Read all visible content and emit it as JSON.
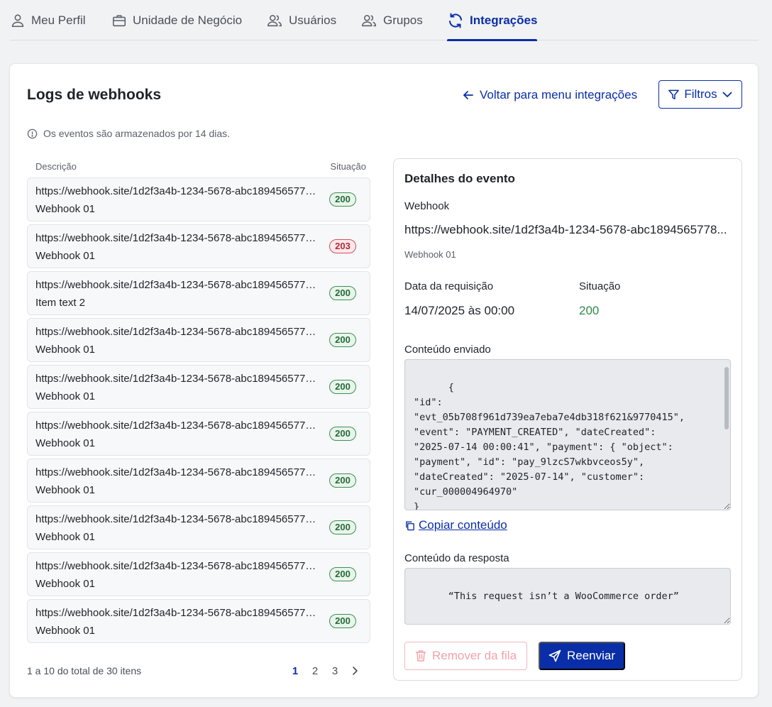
{
  "tabs": [
    {
      "label": "Meu Perfil",
      "icon": "user-icon"
    },
    {
      "label": "Unidade de Negócio",
      "icon": "briefcase-icon"
    },
    {
      "label": "Usuários",
      "icon": "users-icon"
    },
    {
      "label": "Grupos",
      "icon": "users-icon"
    },
    {
      "label": "Integrações",
      "icon": "sync-icon",
      "active": true
    }
  ],
  "header": {
    "title": "Logs de webhooks",
    "back_label": "Voltar para menu integrações",
    "filters_label": "Filtros",
    "info_note": "Os eventos são armazenados por 14 dias."
  },
  "list": {
    "col_description": "Descrição",
    "col_status": "Situação",
    "items": [
      {
        "url": "https://webhook.site/1d2f3a4b-1234-5678-abc1894565778...",
        "name": "Webhook 01",
        "status": "200"
      },
      {
        "url": "https://webhook.site/1d2f3a4b-1234-5678-abc1894565778...",
        "name": "Webhook 01",
        "status": "203"
      },
      {
        "url": "https://webhook.site/1d2f3a4b-1234-5678-abc1894565778...",
        "name": "Item text 2",
        "status": "200"
      },
      {
        "url": "https://webhook.site/1d2f3a4b-1234-5678-abc1894565778...",
        "name": "Webhook 01",
        "status": "200"
      },
      {
        "url": "https://webhook.site/1d2f3a4b-1234-5678-abc1894565778...",
        "name": "Webhook 01",
        "status": "200"
      },
      {
        "url": "https://webhook.site/1d2f3a4b-1234-5678-abc1894565778...",
        "name": "Webhook 01",
        "status": "200"
      },
      {
        "url": "https://webhook.site/1d2f3a4b-1234-5678-abc1894565778...",
        "name": "Webhook 01",
        "status": "200"
      },
      {
        "url": "https://webhook.site/1d2f3a4b-1234-5678-abc1894565778...",
        "name": "Webhook 01",
        "status": "200"
      },
      {
        "url": "https://webhook.site/1d2f3a4b-1234-5678-abc1894565778...",
        "name": "Webhook 01",
        "status": "200"
      },
      {
        "url": "https://webhook.site/1d2f3a4b-1234-5678-abc1894565778...",
        "name": "Webhook 01",
        "status": "200"
      }
    ]
  },
  "pagination": {
    "info": "1 a 10 do total de 30 itens",
    "pages": [
      "1",
      "2",
      "3"
    ],
    "current": "1"
  },
  "details": {
    "title": "Detalhes do evento",
    "webhook_label": "Webhook",
    "webhook_url": "https://webhook.site/1d2f3a4b-1234-5678-abc1894565778...",
    "webhook_name": "Webhook 01",
    "date_label": "Data da requisição",
    "date_value": "14/07/2025 às 00:00",
    "status_label": "Situação",
    "status_value": "200",
    "sent_label": "Conteúdo enviado",
    "sent_content": "{\n\"id\":\n\"evt_05b708f961d739ea7eba7e4db318f621&9770415\",\n\"event\": \"PAYMENT_CREATED\", \"dateCreated\":\n\"2025-07-14 00:00:41\", \"payment\": { \"object\":\n\"payment\", \"id\": \"pay_9lzcS7wkbvceos5y\",\n\"dateCreated\": \"2025-07-14\", \"customer\":\n\"cur_000004964970\"\n}",
    "copy_label": "Copiar conteúdo",
    "response_label": "Conteúdo da resposta",
    "response_content": "“This request isn’t a WooCommerce order”",
    "remove_label": "Remover da fila",
    "resend_label": "Reenviar"
  },
  "colors": {
    "primary": "#0a2ea8",
    "success": "#2e8a4a",
    "danger": "#b02a37"
  }
}
